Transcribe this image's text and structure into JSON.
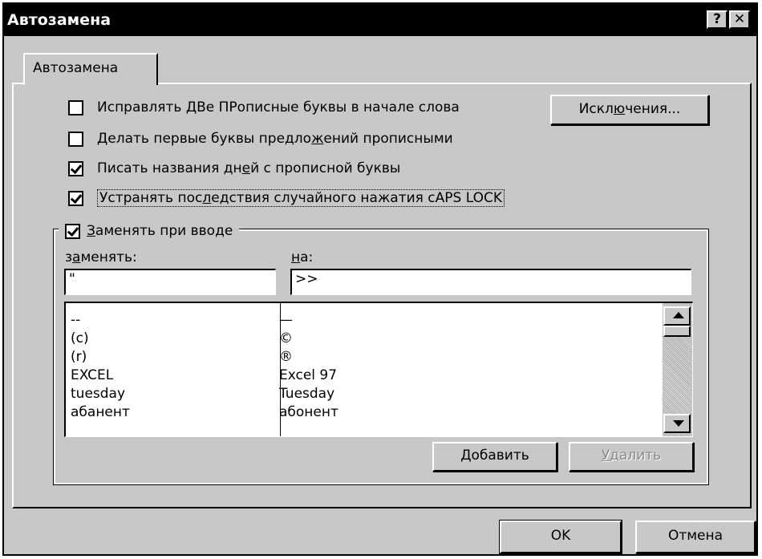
{
  "window": {
    "title": "Автозамена",
    "help_glyph": "?",
    "close_glyph": "✕"
  },
  "tab": {
    "label": "Автозамена"
  },
  "options": [
    {
      "text": "Исправлять ДВе ПРописные буквы в начале слова",
      "checked": false
    },
    {
      "text": "Делать первые буквы предложений прописными",
      "checked": false
    },
    {
      "text": "Писать названия дней с прописной буквы",
      "checked": true
    },
    {
      "text": "Устранять последствия случайного нажатия cAPS LOCK",
      "checked": true
    }
  ],
  "exceptions_button": "Исключения...",
  "replace_group": {
    "label": "Заменять при вводе",
    "checked": true,
    "replace_label": "заменять:",
    "with_label": "на:",
    "replace_value": "\"",
    "with_value": ">>"
  },
  "entries": [
    {
      "from": "--",
      "to": "—"
    },
    {
      "from": "(c)",
      "to": "©"
    },
    {
      "from": "(r)",
      "to": "®"
    },
    {
      "from": "EXCEL",
      "to": "Excel 97"
    },
    {
      "from": "tuesday",
      "to": "Tuesday"
    },
    {
      "from": "абанент",
      "to": "абонент"
    }
  ],
  "buttons": {
    "add": "Добавить",
    "delete": "Удалить",
    "ok": "OK",
    "cancel": "Отмена"
  }
}
